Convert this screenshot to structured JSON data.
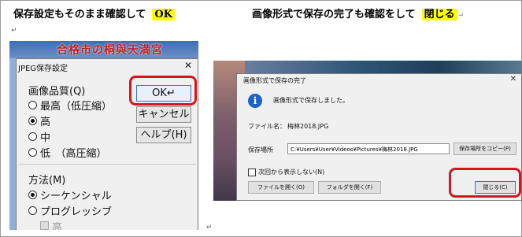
{
  "headings": {
    "left_text": "保存設定もそのまま確認して",
    "left_highlight": "OK",
    "right_text": "画像形式で保存の完了も確認をして",
    "right_highlight": "閉じる",
    "para_mark": "↵"
  },
  "left_screenshot": {
    "background_text": "合格市の桐與天満宮",
    "dialog": {
      "title": "JPEG保存設定",
      "close_glyph": "✕",
      "quality_label": "画像品質(Q)",
      "quality_options": [
        "最高（低圧縮）",
        "高",
        "中",
        "低　（高圧縮）"
      ],
      "quality_selected": "高",
      "method_label": "方法(M)",
      "method_options": [
        "シーケンシャル",
        "プログレッシブ"
      ],
      "method_selected": "シーケンシャル",
      "method_sub_option": "高",
      "ok_label": "OK↵",
      "cancel_label": "キャンセル",
      "help_label": "ヘルプ(H)"
    }
  },
  "right_screenshot": {
    "dialog": {
      "title": "画像形式で保存の完了",
      "close_glyph": "✕",
      "info_icon": "i",
      "message": "画像形式で保存しました。",
      "filename_label": "ファイル名：",
      "filename_value": "梅林2018.JPG",
      "location_label": "保存場所",
      "location_value": "C:¥Users¥User¥Videos¥Pictures¥梅林2018.JPG",
      "copy_location_label": "保存場所をコピー(P)",
      "dont_show_label": "次回から表示しない(N)",
      "open_file_label": "ファイルを開く(O)",
      "open_folder_label": "フォルダを開く(F)",
      "close_label": "閉じる(C)"
    }
  },
  "colors": {
    "highlight": "#ffff00",
    "annotation_ring": "#d8141e",
    "info_icon": "#1b63c6"
  }
}
